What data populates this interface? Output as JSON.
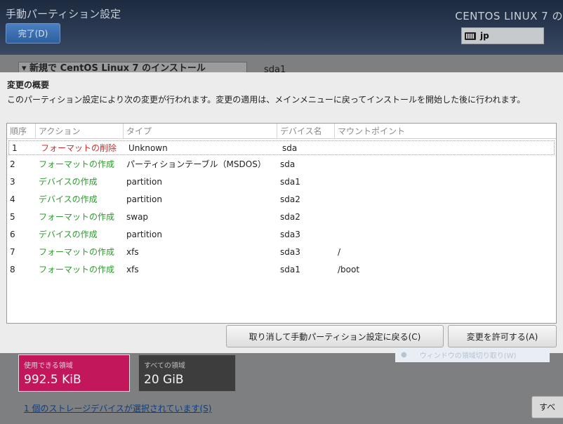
{
  "header": {
    "title": "手動パーティション設定",
    "done_label": "完了(D)",
    "product": "CENTOS LINUX 7 の",
    "keyboard_layout": "jp"
  },
  "background": {
    "scheme_selector": "▾ 新規で CentOS Linux 7 のインストール",
    "device_label": "sda1",
    "available_space_label": "使用できる領域",
    "available_space_value": "992.5 KiB",
    "total_space_label": "すべての領域",
    "total_space_value": "20 GiB",
    "storage_link": "1 個のストレージデバイスが選択されています(S)",
    "reset_label": "すべ"
  },
  "dialog": {
    "title": "変更の概要",
    "description": "このパーティション設定により次の変更が行われます。変更の適用は、メインメニューに戻ってインストールを開始した後に行われます。",
    "columns": [
      "順序",
      "アクション",
      "タイプ",
      "デバイス名",
      "マウントポイント"
    ],
    "rows": [
      {
        "order": "1",
        "action": "フォーマットの削除",
        "type": "Unknown",
        "device": "sda",
        "mount": ""
      },
      {
        "order": "2",
        "action": "フォーマットの作成",
        "type": "パーティションテーブル（MSDOS）",
        "device": "sda",
        "mount": ""
      },
      {
        "order": "3",
        "action": "デバイスの作成",
        "type": "partition",
        "device": "sda1",
        "mount": ""
      },
      {
        "order": "4",
        "action": "デバイスの作成",
        "type": "partition",
        "device": "sda2",
        "mount": ""
      },
      {
        "order": "5",
        "action": "フォーマットの作成",
        "type": "swap",
        "device": "sda2",
        "mount": ""
      },
      {
        "order": "6",
        "action": "デバイスの作成",
        "type": "partition",
        "device": "sda3",
        "mount": ""
      },
      {
        "order": "7",
        "action": "フォーマットの作成",
        "type": "xfs",
        "device": "sda3",
        "mount": "/"
      },
      {
        "order": "8",
        "action": "フォーマットの作成",
        "type": "xfs",
        "device": "sda1",
        "mount": "/boot"
      }
    ],
    "faded_tooltip": "ウィンドウの領域切り取り(W)",
    "cancel_label": "取り消して手動パーティション設定に戻る(C)",
    "accept_label": "変更を許可する(A)"
  },
  "colors": {
    "delete_action": "#d42a2a",
    "create_action": "#2e9a2e",
    "available_space_bg": "#c2185b"
  }
}
